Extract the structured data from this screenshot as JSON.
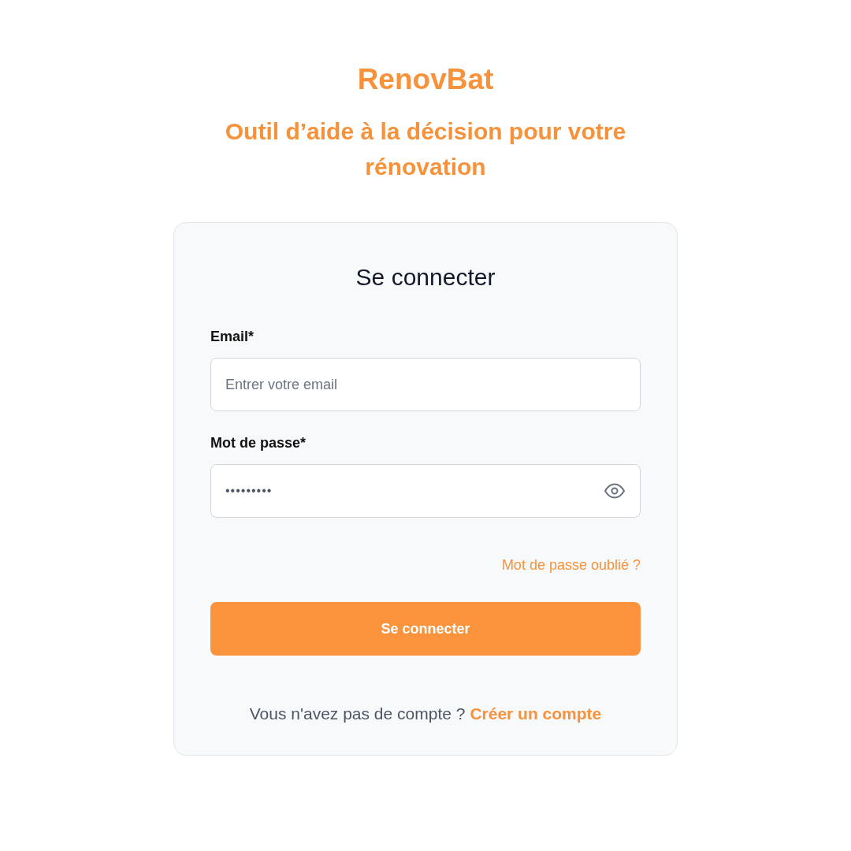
{
  "brand": "RenovBat",
  "tagline": "Outil d’aide à la décision pour votre rénovation",
  "form": {
    "title": "Se connecter",
    "fields": [
      {
        "kind": "email",
        "label": "Email*",
        "placeholder": "Entrer votre email"
      },
      {
        "kind": "password",
        "label": "Mot de passe*",
        "value": "•••••••••"
      }
    ],
    "forgot_link": "Mot de passe oublié ?",
    "submit": "Se connecter",
    "signup_prompt": "Vous n'avez pas de compte ?",
    "signup_link": "Créer un compte"
  }
}
